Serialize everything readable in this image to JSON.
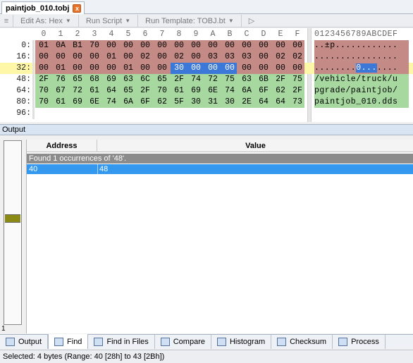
{
  "tab": {
    "title": "paintjob_010.tobj",
    "close_glyph": "x"
  },
  "toolbar": {
    "edit_as": "Edit As: Hex",
    "run_script": "Run Script",
    "run_template": "Run Template: TOBJ.bt",
    "play_glyph": "▷"
  },
  "hex": {
    "column_headers": [
      "0",
      "1",
      "2",
      "3",
      "4",
      "5",
      "6",
      "7",
      "8",
      "9",
      "A",
      "B",
      "C",
      "D",
      "E",
      "F"
    ],
    "ascii_header": "0123456789ABCDEF",
    "rows": [
      {
        "address": "0:",
        "bytes": [
          "01",
          "0A",
          "B1",
          "70",
          "00",
          "00",
          "00",
          "00",
          "00",
          "00",
          "00",
          "00",
          "00",
          "00",
          "00",
          "00"
        ],
        "ascii": "..±p............"
      },
      {
        "address": "16:",
        "bytes": [
          "00",
          "00",
          "00",
          "00",
          "01",
          "00",
          "02",
          "00",
          "02",
          "00",
          "03",
          "03",
          "03",
          "00",
          "02",
          "02"
        ],
        "ascii": "................"
      },
      {
        "address": "32:",
        "bytes": [
          "00",
          "01",
          "00",
          "00",
          "00",
          "01",
          "00",
          "00",
          "30",
          "00",
          "00",
          "00",
          "00",
          "00",
          "00",
          "00"
        ],
        "ascii": "........0......."
      },
      {
        "address": "48:",
        "bytes": [
          "2F",
          "76",
          "65",
          "68",
          "69",
          "63",
          "6C",
          "65",
          "2F",
          "74",
          "72",
          "75",
          "63",
          "6B",
          "2F",
          "75"
        ],
        "ascii": "/vehicle/truck/u"
      },
      {
        "address": "64:",
        "bytes": [
          "70",
          "67",
          "72",
          "61",
          "64",
          "65",
          "2F",
          "70",
          "61",
          "69",
          "6E",
          "74",
          "6A",
          "6F",
          "62",
          "2F"
        ],
        "ascii": "pgrade/paintjob/"
      },
      {
        "address": "80:",
        "bytes": [
          "70",
          "61",
          "69",
          "6E",
          "74",
          "6A",
          "6F",
          "62",
          "5F",
          "30",
          "31",
          "30",
          "2E",
          "64",
          "64",
          "73"
        ],
        "ascii": "paintjob_010.dds"
      },
      {
        "address": "96:",
        "bytes": [],
        "ascii": ""
      }
    ],
    "colors": {
      "struct": "#c48a85",
      "string": "#a6d8a0",
      "selection": "#3c78d8",
      "cursor_row": "#fff7a8"
    }
  },
  "output": {
    "title": "Output",
    "slider_value": "1",
    "slider_level": 0.42,
    "columns": {
      "address": "Address",
      "value": "Value"
    },
    "group_label": "Found 1 occurrences of '48'.",
    "rows": [
      {
        "address": "40",
        "value": "48"
      }
    ]
  },
  "bottom_tabs": [
    {
      "label": "Output",
      "icon": "output-icon"
    },
    {
      "label": "Find",
      "icon": "find-icon",
      "active": true
    },
    {
      "label": "Find in Files",
      "icon": "find-in-files-icon"
    },
    {
      "label": "Compare",
      "icon": "compare-icon"
    },
    {
      "label": "Histogram",
      "icon": "histogram-icon"
    },
    {
      "label": "Checksum",
      "icon": "checksum-icon"
    },
    {
      "label": "Process",
      "icon": "process-icon"
    }
  ],
  "status": {
    "text": "Selected: 4 bytes (Range: 40 [28h] to 43 [2Bh])"
  }
}
